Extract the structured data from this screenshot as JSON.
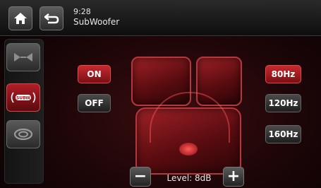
{
  "header": {
    "time": "9:28",
    "title": "SubWoofer"
  },
  "subwoofer": {
    "on_label": "ON",
    "off_label": "OFF",
    "state": "ON"
  },
  "crossover": {
    "options": [
      "80Hz",
      "120Hz",
      "160Hz"
    ],
    "selected": "80Hz"
  },
  "level": {
    "label": "Level: 8dB",
    "minus_symbol": "−",
    "plus_symbol": "+"
  },
  "sidebar": {
    "items": [
      {
        "icon": "balance-icon",
        "active": false
      },
      {
        "icon": "subwoofer-icon",
        "active": true
      },
      {
        "icon": "surround-icon",
        "active": false
      }
    ]
  },
  "colors": {
    "accent": "#c52a30",
    "background": "#1a0507"
  }
}
